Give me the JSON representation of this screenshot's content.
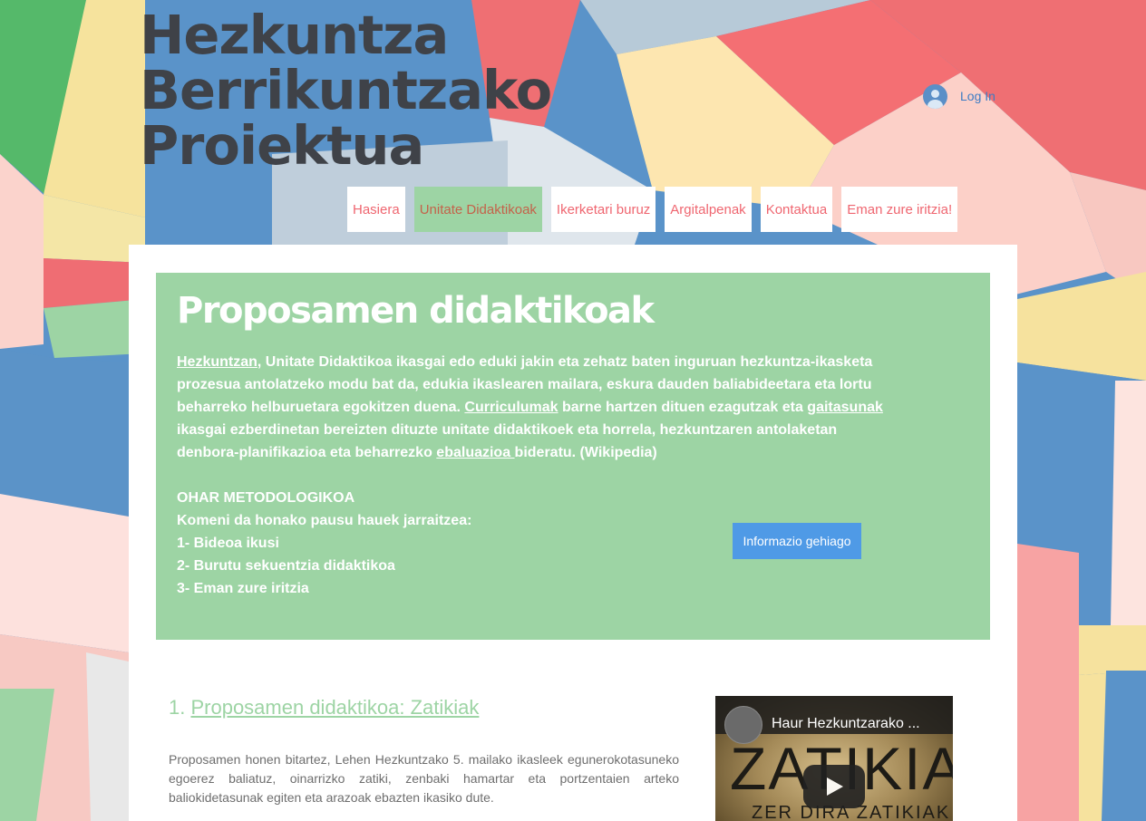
{
  "site": {
    "title_lines": [
      "Hezkuntza",
      "Berrikuntzako",
      "Proiektua"
    ]
  },
  "header": {
    "login_label": "Log In"
  },
  "nav": [
    {
      "label": "Hasiera",
      "active": false
    },
    {
      "label": "Unitate Didaktikoak",
      "active": true
    },
    {
      "label": "Ikerketari buruz",
      "active": false
    },
    {
      "label": "Argitalpenak",
      "active": false
    },
    {
      "label": "Kontaktua",
      "active": false
    },
    {
      "label": "Eman zure iritzia!",
      "active": false
    }
  ],
  "intro": {
    "title": "Proposamen didaktikoak",
    "p1": [
      {
        "text": "Hezkuntzan",
        "link": true
      },
      {
        "text": ", Unitate Didaktikoa ikasgai edo eduki jakin eta zehatz baten inguruan hezkuntza-ikasketa prozesua antolatzeko modu bat da, edukia ikaslearen mailara, eskura dauden baliabideetara eta lortu beharreko helburuetara egokitzen duena. ",
        "link": false
      },
      {
        "text": "Curriculumak",
        "link": true
      },
      {
        "text": " barne hartzen dituen ezagutzak eta ",
        "link": false
      },
      {
        "text": "gaitasunak",
        "link": true
      },
      {
        "text": " ikasgai ezberdinetan bereizten dituzte unitate didaktikoek eta horrela, hezkuntzaren antolaketan denbora-planifikazioa eta beharrezko ",
        "link": false
      },
      {
        "text": "ebaluazioa ",
        "link": true
      },
      {
        "text": "bideratu. (Wikipedia)",
        "link": false
      }
    ],
    "note_heading": "OHAR METODOLOGIKOA",
    "note_intro": "Komeni da honako pausu hauek jarraitzea:",
    "steps": [
      "1- Bideoa ikusi",
      "2- Burutu sekuentzia didaktikoa",
      "3- Eman zure iritzia"
    ],
    "more_button": "Informazio gehiago"
  },
  "section1": {
    "number": "1. ",
    "title": "Proposamen didaktikoa: Zatikiak",
    "text": "Proposamen honen bitartez, Lehen Hezkuntzako 5. mailako ikasleek egunerokotasuneko egoerez baliatuz, oinarrizko zatiki, zenbaki hamartar eta portzentaien arteko baliokidetasunak egiten eta arazoak ebazten ikasiko dute."
  },
  "video": {
    "title": "Haur Hezkuntzarako ...",
    "thumb_big": "ZATIKIAK",
    "thumb_small": "ZER DIRA ZATIKIAK"
  },
  "colors": {
    "accent_green": "#9dd4a4",
    "nav_text": "#ef6670",
    "title_text": "#3f4248",
    "button_blue": "#4f9ae6",
    "login_blue": "#3d7cc4"
  }
}
